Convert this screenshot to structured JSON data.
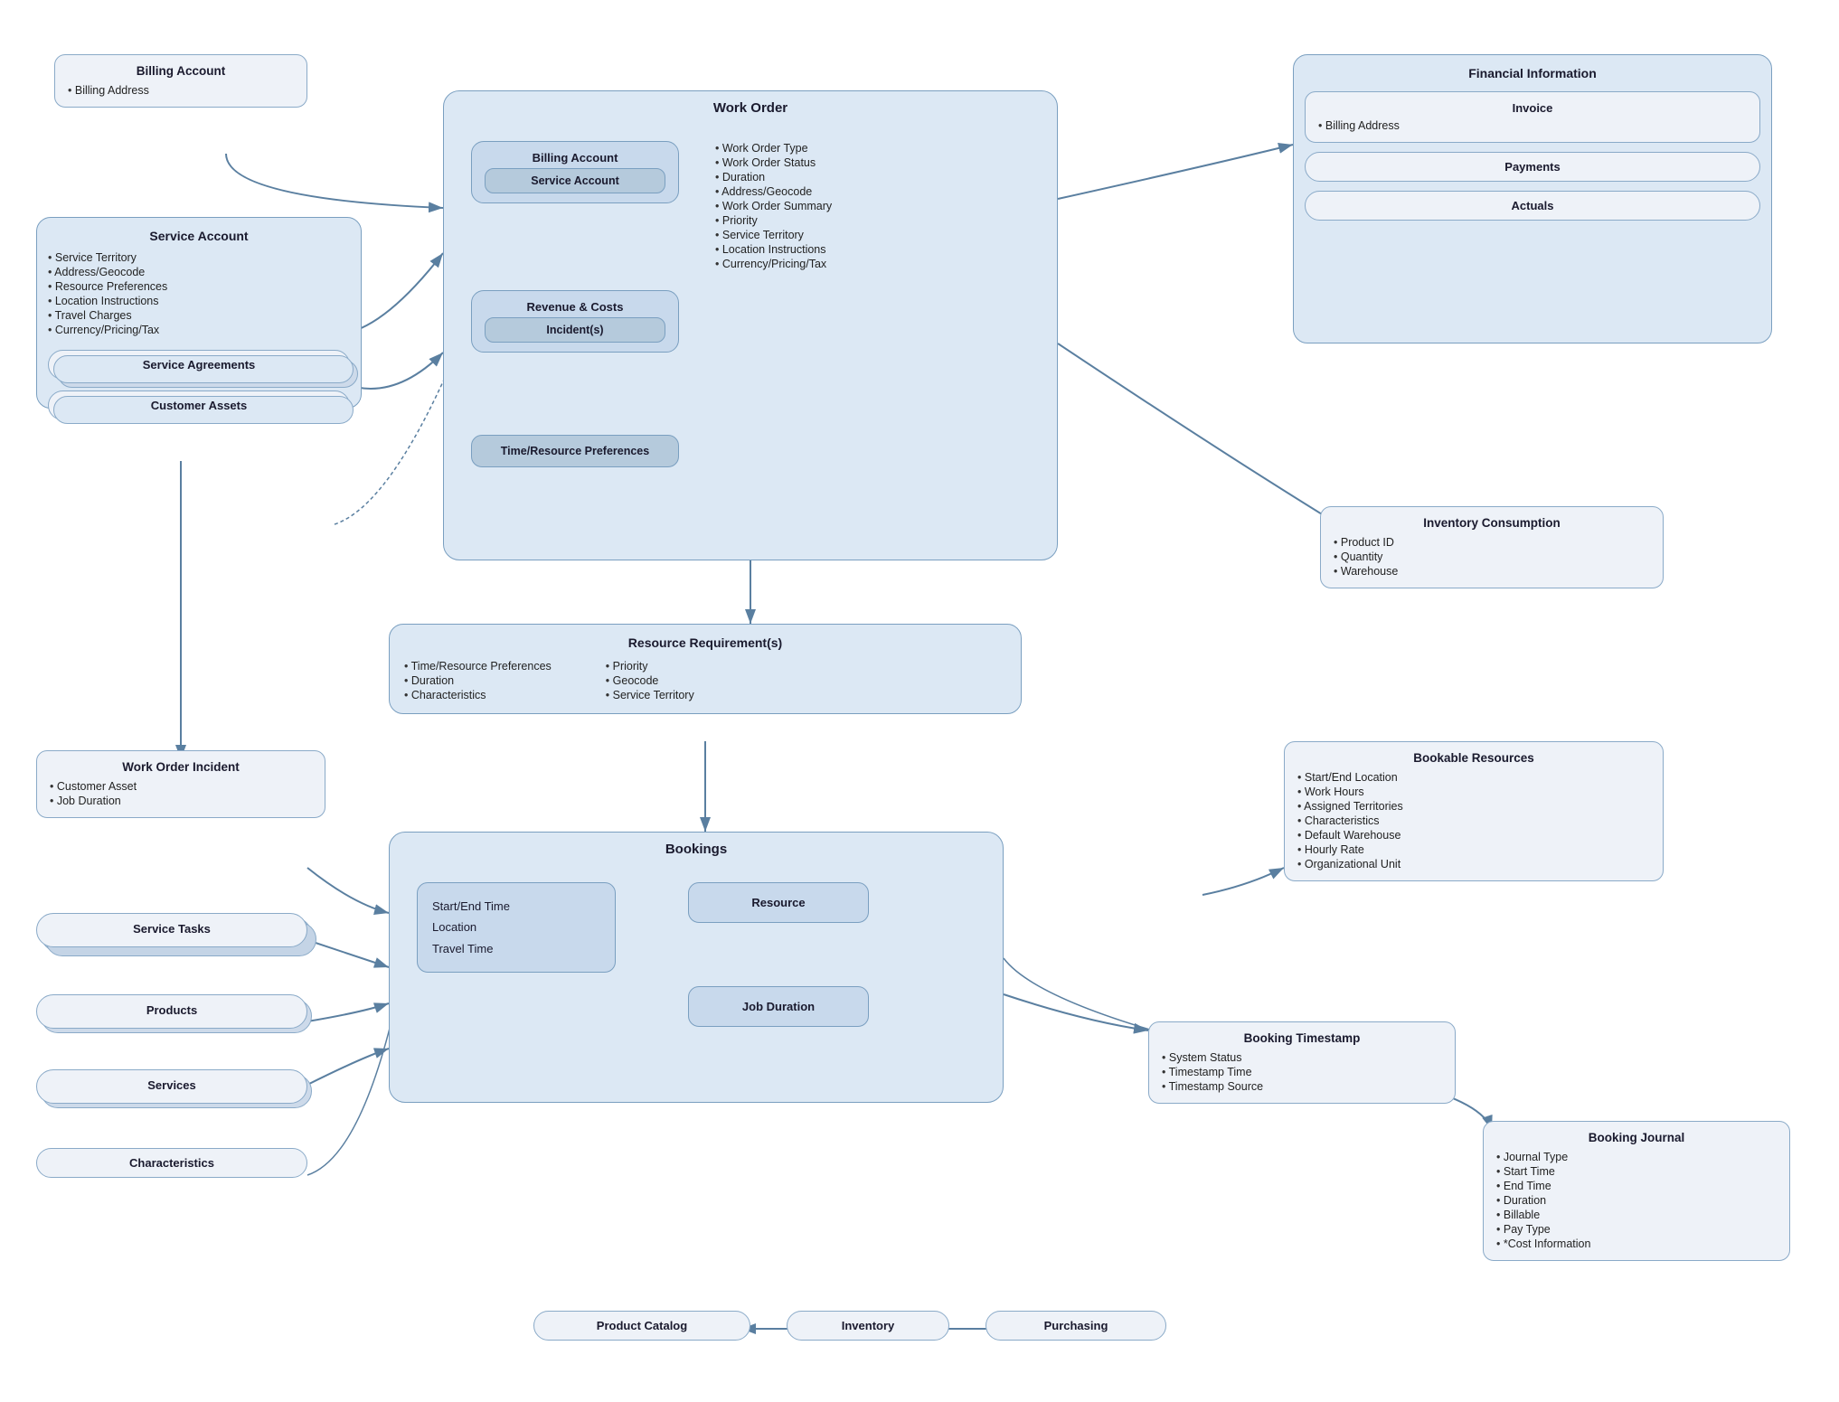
{
  "billing_account_top": {
    "title": "Billing Account",
    "items": [
      "Billing Address"
    ]
  },
  "service_account": {
    "title": "Service Account",
    "items": [
      "Service Territory",
      "Address/Geocode",
      "Resource Preferences",
      "Location Instructions",
      "Travel Charges",
      "Currency/Pricing/Tax"
    ]
  },
  "service_agreements": {
    "label": "Service Agreements"
  },
  "customer_assets": {
    "label": "Customer Assets"
  },
  "work_order_incident": {
    "title": "Work Order Incident",
    "items": [
      "Customer Asset",
      "Job Duration"
    ]
  },
  "service_tasks": {
    "label": "Service Tasks"
  },
  "products": {
    "label": "Products"
  },
  "services": {
    "label": "Services"
  },
  "characteristics": {
    "label": "Characteristics"
  },
  "product_catalog": {
    "label": "Product Catalog"
  },
  "inventory": {
    "label": "Inventory"
  },
  "purchasing": {
    "label": "Purchasing"
  },
  "work_order": {
    "title": "Work Order",
    "billing_account": "Billing Account",
    "service_account": "Service Account",
    "revenue_costs": "Revenue & Costs",
    "incidents": "Incident(s)",
    "time_resource": "Time/Resource Preferences",
    "items": [
      "Work Order Type",
      "Work Order Status",
      "Duration",
      "Address/Geocode",
      "Work Order Summary",
      "Priority",
      "Service Territory",
      "Location Instructions",
      "Currency/Pricing/Tax"
    ]
  },
  "resource_requirements": {
    "title": "Resource Requirement(s)",
    "left_items": [
      "Time/Resource Preferences",
      "Duration",
      "Characteristics"
    ],
    "right_items": [
      "Priority",
      "Geocode",
      "Service Territory"
    ]
  },
  "bookings": {
    "title": "Bookings",
    "left_items": [
      "Start/End Time",
      "Location",
      "Travel Time"
    ],
    "resource_label": "Resource",
    "job_duration_label": "Job Duration"
  },
  "financial_information": {
    "title": "Financial Information",
    "invoice": "Invoice",
    "invoice_items": [
      "Billing Address"
    ],
    "payments": "Payments",
    "actuals": "Actuals"
  },
  "inventory_consumption": {
    "title": "Inventory Consumption",
    "items": [
      "Product ID",
      "Quantity",
      "Warehouse"
    ]
  },
  "bookable_resources": {
    "title": "Bookable Resources",
    "items": [
      "Start/End Location",
      "Work Hours",
      "Assigned Territories",
      "Characteristics",
      "Default Warehouse",
      "Hourly Rate",
      "Organizational Unit"
    ]
  },
  "booking_timestamp": {
    "title": "Booking Timestamp",
    "items": [
      "System Status",
      "Timestamp Time",
      "Timestamp Source"
    ]
  },
  "booking_journal": {
    "title": "Booking Journal",
    "items": [
      "Journal Type",
      "Start Time",
      "End Time",
      "Duration",
      "Billable",
      "Pay Type",
      "*Cost Information"
    ]
  },
  "colors": {
    "box_bg": "#eef2f8",
    "box_border": "#8aaac8",
    "outer_bg": "#dce8f4",
    "outer_border": "#7a9fc0",
    "inner_bg": "#c8d9ec",
    "arrow": "#5a7fa0"
  }
}
